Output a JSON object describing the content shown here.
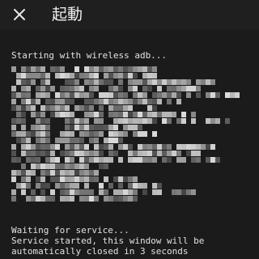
{
  "app_bar": {
    "title": "起動",
    "close_icon": "close-icon"
  },
  "console": {
    "start_message": "Starting with wireless adb...",
    "log_output_redacted": true,
    "waiting_message": "Waiting for service...",
    "started_message": "Service started, this window will be",
    "closing_message": "automatically closed in 3 seconds"
  },
  "colors": {
    "background": "#1b1b1b",
    "text": "#e2e2e2"
  }
}
